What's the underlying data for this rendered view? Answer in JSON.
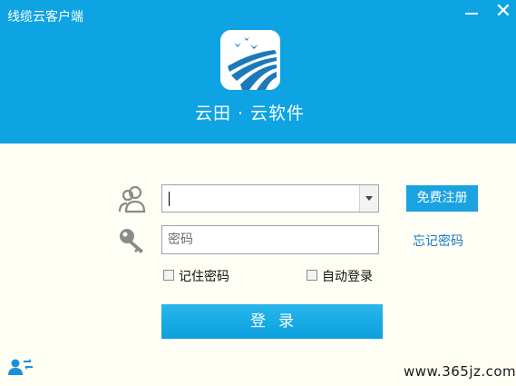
{
  "window": {
    "title": "线缆云客户端",
    "minimize_icon": "minimize-icon",
    "close_label": "✕"
  },
  "brand": {
    "logo_icon": "bird-field-logo",
    "name": "云田 · 云软件",
    "header_color": "#0ea3e2"
  },
  "login": {
    "username": {
      "value": "",
      "icon": "user-icon",
      "dropdown_icon": "chevron-down-icon"
    },
    "password": {
      "placeholder": "密码",
      "icon": "key-icon"
    },
    "register_label": "免费注册",
    "forgot_label": "忘记密码",
    "remember_label": "记住密码",
    "auto_login_label": "自动登录",
    "submit_label": "登录",
    "accent_color": "#1aa3e0"
  },
  "footer": {
    "switch_account_icon": "switch-account-icon",
    "watermark": "www.365jz.com"
  }
}
